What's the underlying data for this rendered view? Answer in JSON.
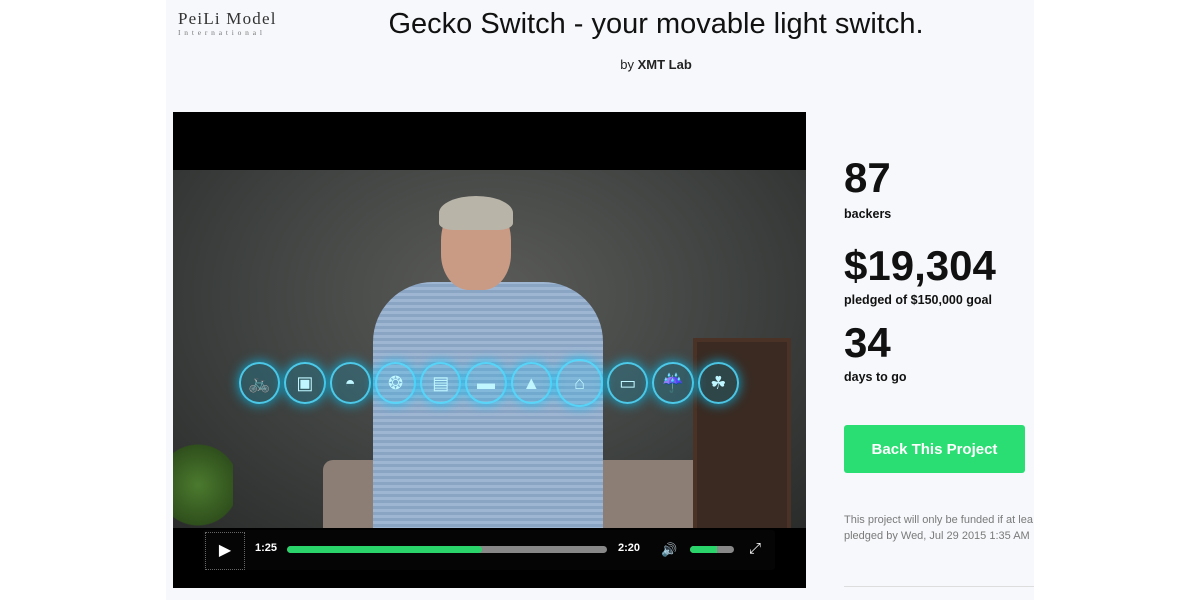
{
  "logo": {
    "main": "PeiLi Model",
    "sub": "International"
  },
  "project": {
    "title": "Gecko Switch - your movable light switch.",
    "by_prefix": "by",
    "creator": "XMT Lab"
  },
  "video": {
    "current_time": "1:25",
    "total_time": "2:20",
    "progress_percent": 61,
    "volume_percent": 62,
    "icons": [
      "bicycle-icon",
      "washer-icon",
      "dish-icon",
      "stroller-icon",
      "toaster-icon",
      "sofa-icon",
      "car-icon",
      "home-icon",
      "bed-icon",
      "shower-icon",
      "plant-icon"
    ]
  },
  "stats": {
    "backers_count": "87",
    "backers_label": "backers",
    "pledged_amount": "$19,304",
    "pledged_label": "pledged of $150,000 goal",
    "days_count": "34",
    "days_label": "days to go"
  },
  "cta": {
    "label": "Back This Project",
    "color": "#2bde73"
  },
  "note": {
    "line1": "This project will only be funded if at lea",
    "line2": "pledged by Wed, Jul 29 2015 1:35 AM"
  }
}
